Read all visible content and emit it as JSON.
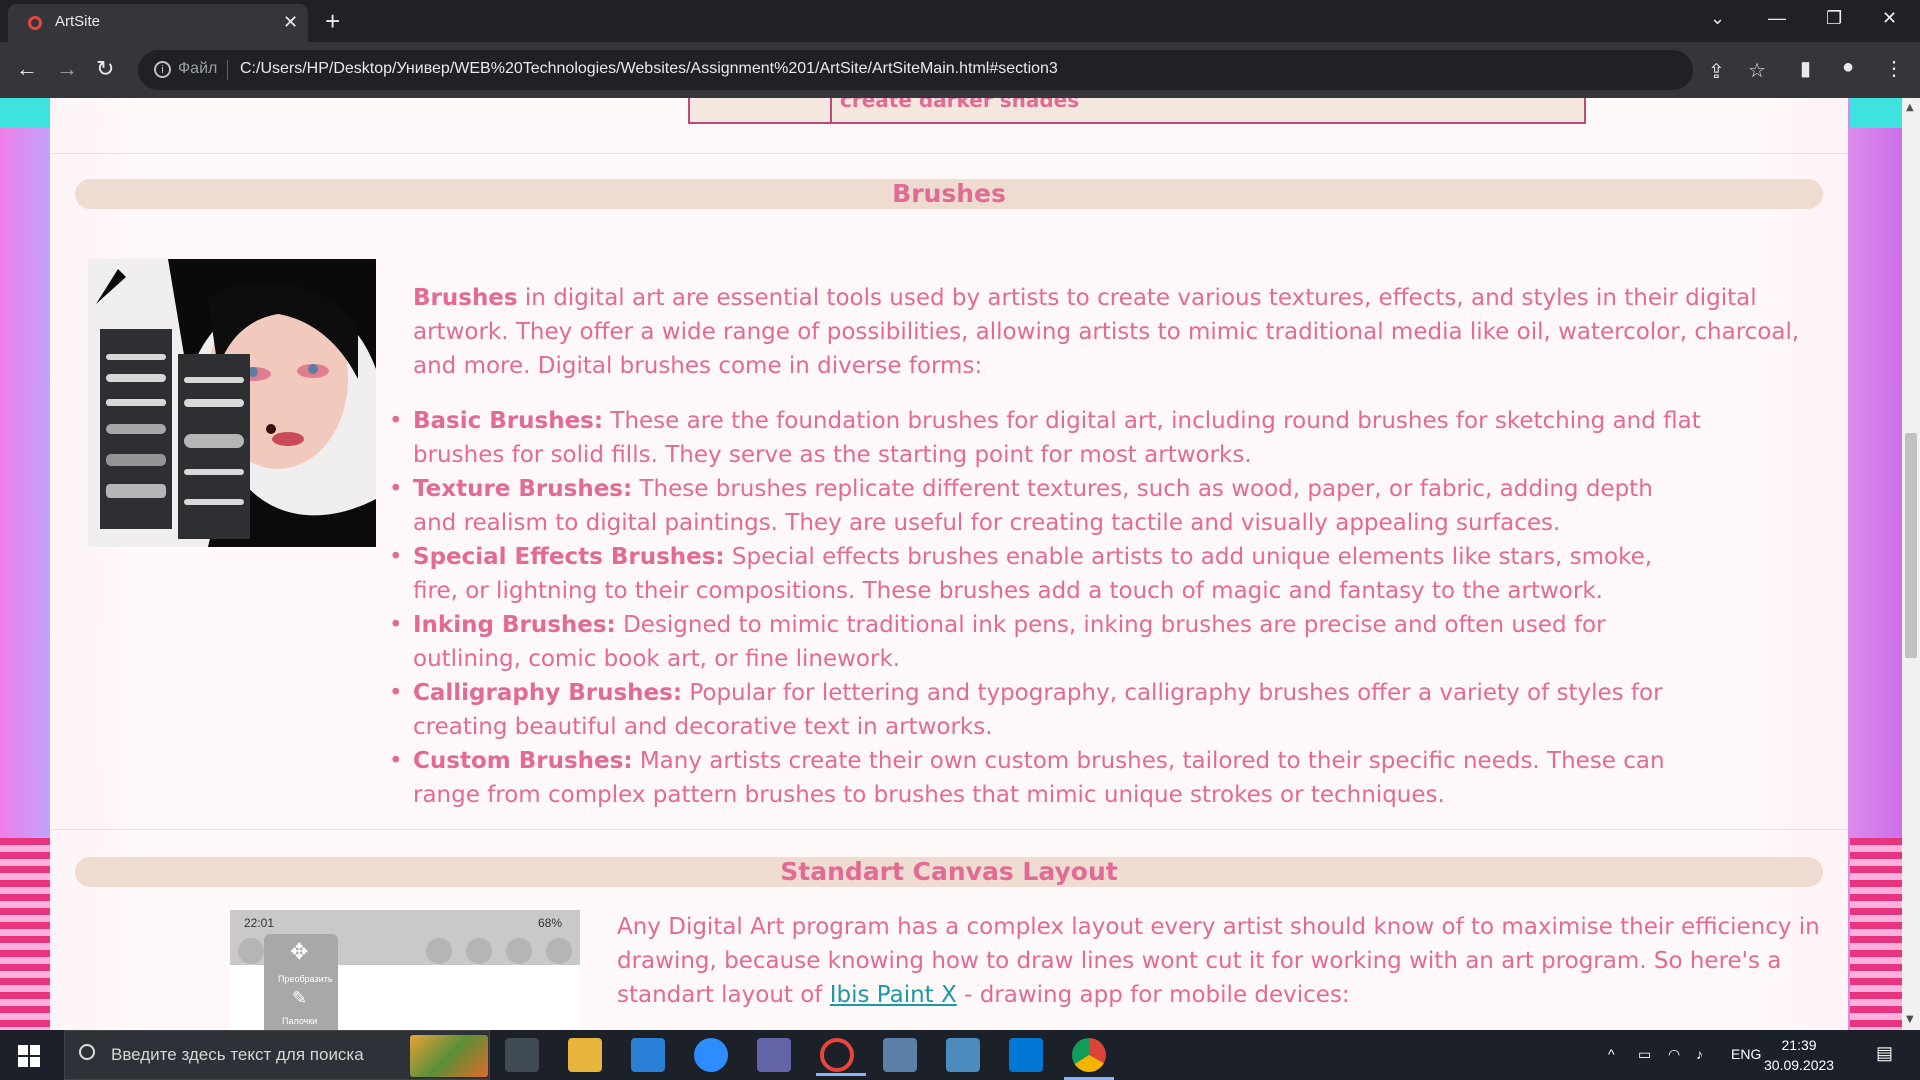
{
  "browser": {
    "tab_title": "ArtSite",
    "omnibox_file_label": "Файл",
    "url": "C:/Users/HP/Desktop/Универ/WEB%20Technologies/Websites/Assignment%201/ArtSite/ArtSiteMain.html#section3"
  },
  "page": {
    "prev_table_text": "create darker shades",
    "brushes": {
      "heading": "Brushes",
      "intro_bold": "Brushes",
      "intro_text": " in digital art are essential tools used by artists to create various textures, effects, and styles in their digital artwork. They offer a wide range of possibilities, allowing artists to mimic traditional media like oil, watercolor, charcoal, and more. Digital brushes come in diverse forms:",
      "items": [
        {
          "title": "Basic Brushes:",
          "text": " These are the foundation brushes for digital art, including round brushes for sketching and flat brushes for solid fills. They serve as the starting point for most artworks."
        },
        {
          "title": "Texture Brushes:",
          "text": " These brushes replicate different textures, such as wood, paper, or fabric, adding depth and realism to digital paintings. They are useful for creating tactile and visually appealing surfaces."
        },
        {
          "title": "Special Effects Brushes:",
          "text": " Special effects brushes enable artists to add unique elements like stars, smoke, fire, or lightning to their compositions. These brushes add a touch of magic and fantasy to the artwork."
        },
        {
          "title": "Inking Brushes:",
          "text": " Designed to mimic traditional ink pens, inking brushes are precise and often used for outlining, comic book art, or fine linework."
        },
        {
          "title": "Calligraphy Brushes:",
          "text": " Popular for lettering and typography, calligraphy brushes offer a variety of styles for creating beautiful and decorative text in artworks."
        },
        {
          "title": "Custom Brushes:",
          "text": " Many artists create their own custom brushes, tailored to their specific needs. These can range from complex pattern brushes to brushes that mimic unique strokes or techniques."
        }
      ]
    },
    "canvas": {
      "heading": "Standart Canvas Layout",
      "text_before_link": "Any Digital Art program has a complex layout every artist should know of to maximise their efficiency in drawing, because knowing how to draw lines wont cut it for working with an art program. So here's a standart layout of ",
      "link_text": "Ibis Paint X",
      "text_after_link": " - drawing app for mobile devices:",
      "phone_time": "22:01",
      "phone_battery": "68%",
      "phone_tool_1": "Преобразить",
      "phone_tool_2": "Палочки"
    }
  },
  "taskbar": {
    "search_placeholder": "Введите здесь текст для поиска",
    "lang": "ENG",
    "time": "21:39",
    "date": "30.09.2023"
  },
  "colors": {
    "accent_pink": "#e26a94",
    "link_teal": "#1b9aa6",
    "heading_bg": "#efdcd0"
  }
}
